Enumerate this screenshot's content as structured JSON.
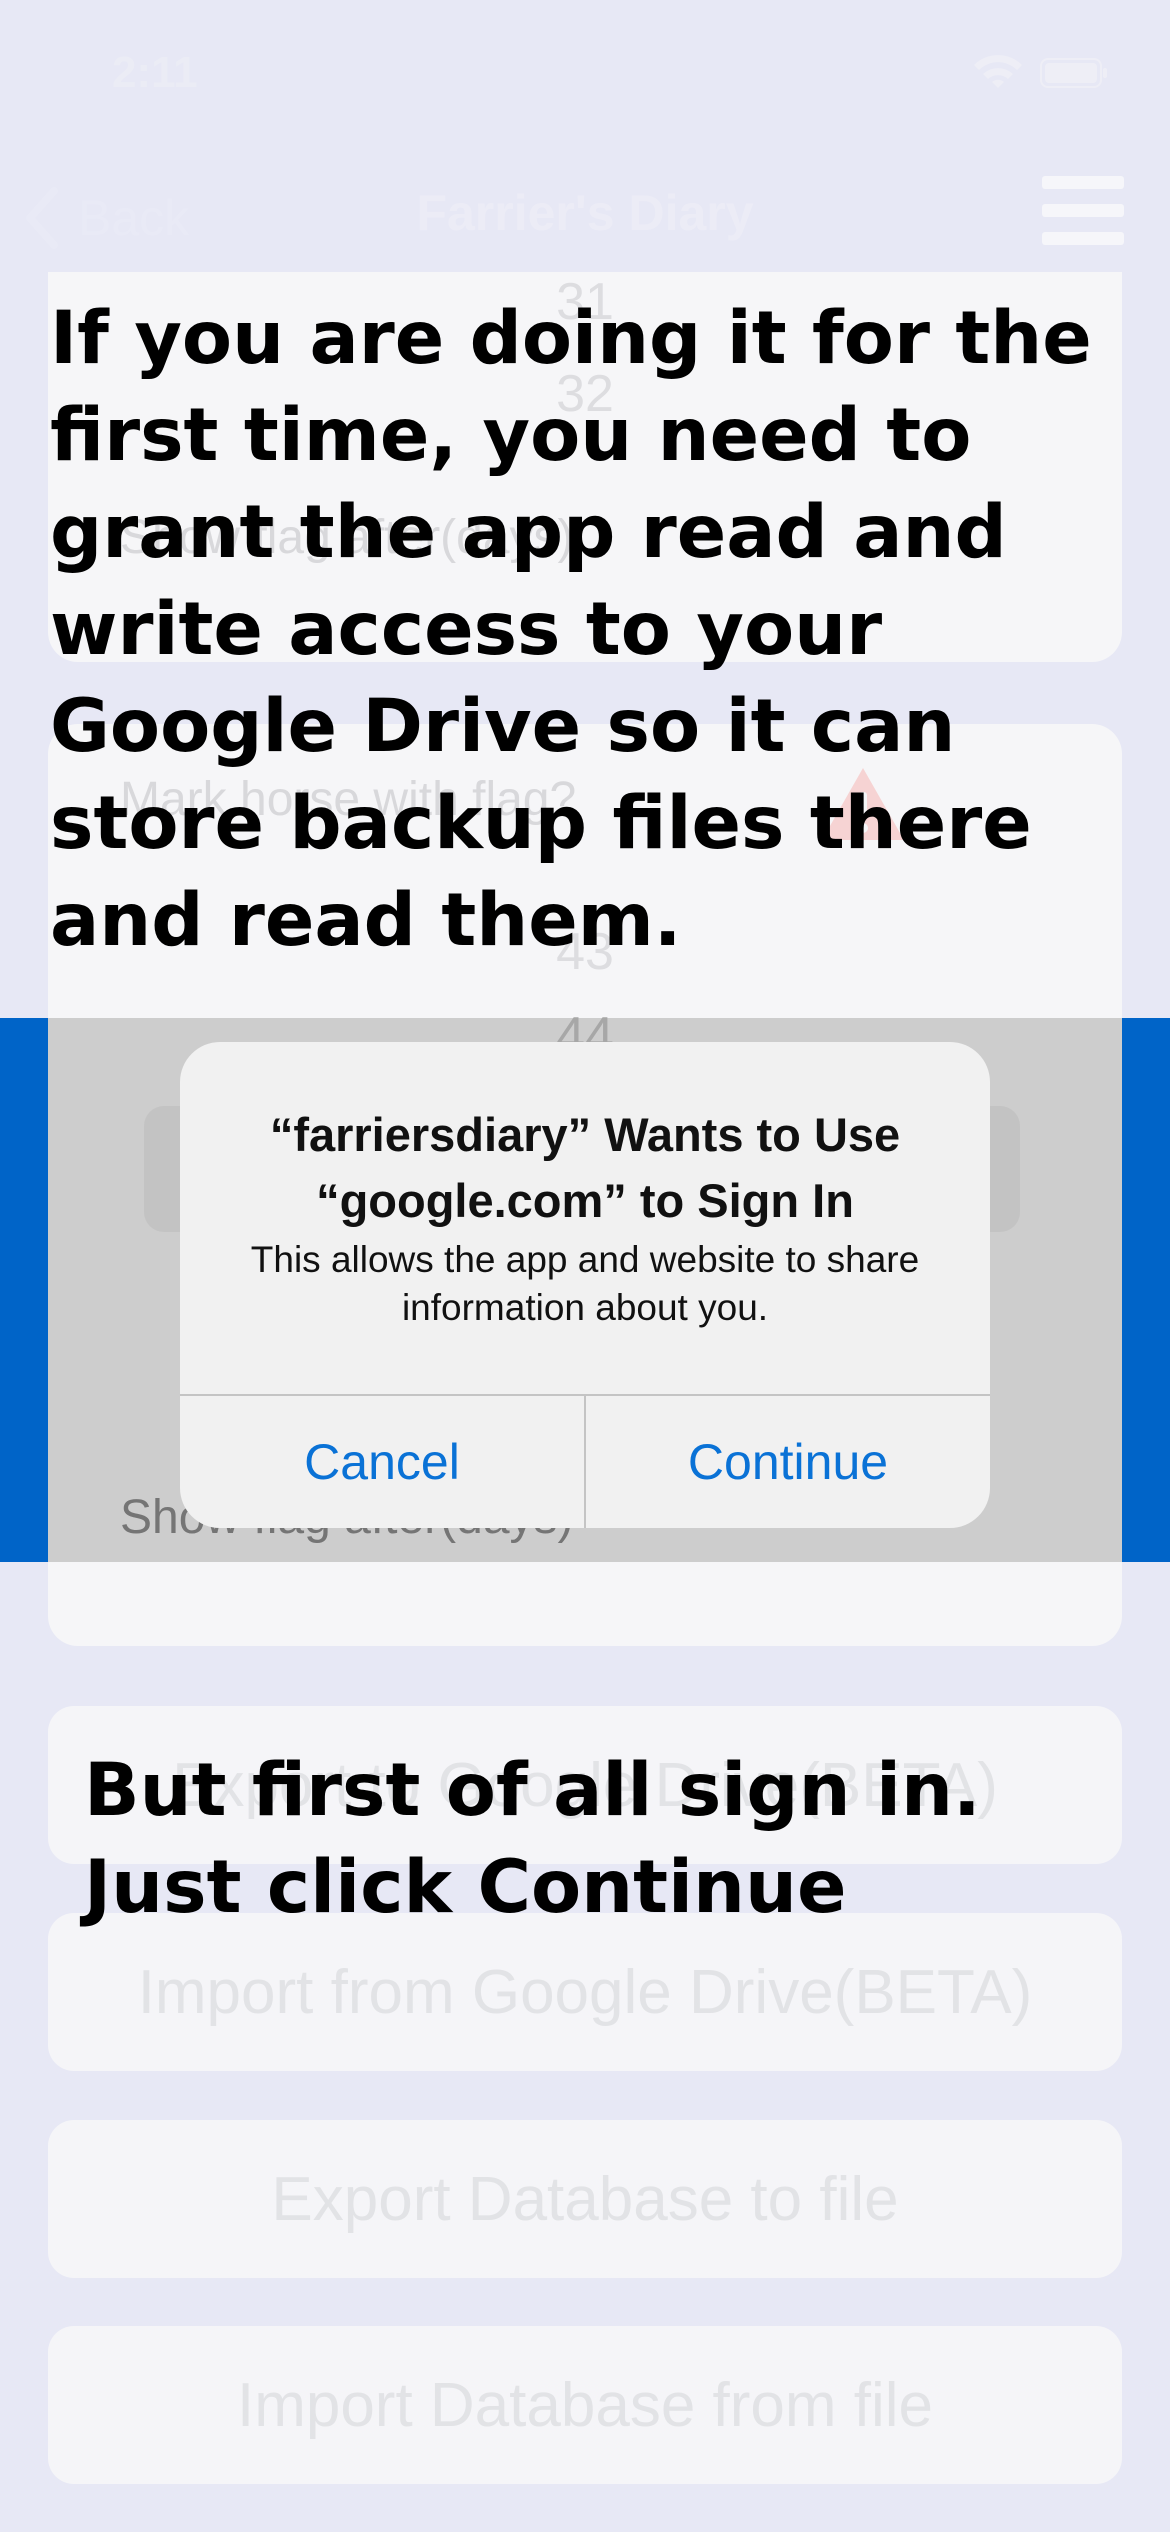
{
  "status_bar": {
    "time": "2:11",
    "wifi_icon": "wifi-icon",
    "battery_icon": "battery-icon"
  },
  "nav": {
    "back_label": "Back",
    "title": "Farrier's Diary",
    "menu_icon": "hamburger-menu-icon"
  },
  "background": {
    "picker_numbers": [
      "31",
      "32"
    ],
    "top_card_label": "Show flag after(days)",
    "settings_label": "Mark horse with flag?",
    "settings_numbers": [
      "43",
      "44"
    ],
    "show_flag_label": "Show flag after(days)",
    "warning_icon": "warning-triangle-icon"
  },
  "buttons": {
    "export_google": "Export to Google Drive(BETA)",
    "import_google": "Import from Google Drive(BETA)",
    "export_file": "Export Database to file",
    "import_file": "Import Database from file"
  },
  "alert": {
    "title": "“farriersdiary” Wants to Use “google.com” to Sign In",
    "message": "This allows the app and website to share information about you.",
    "cancel": "Cancel",
    "continue": "Continue"
  },
  "instructions": {
    "top": "If you are doing it for the first time, you need to grant the app read and write access to your Google Drive so it can store backup files there and read them.",
    "bottom": "But first of all sign in. Just click Continue"
  },
  "colors": {
    "background": "#e7e8f5",
    "accent_blue": "#0064c8",
    "alert_button": "#0a72d6"
  }
}
